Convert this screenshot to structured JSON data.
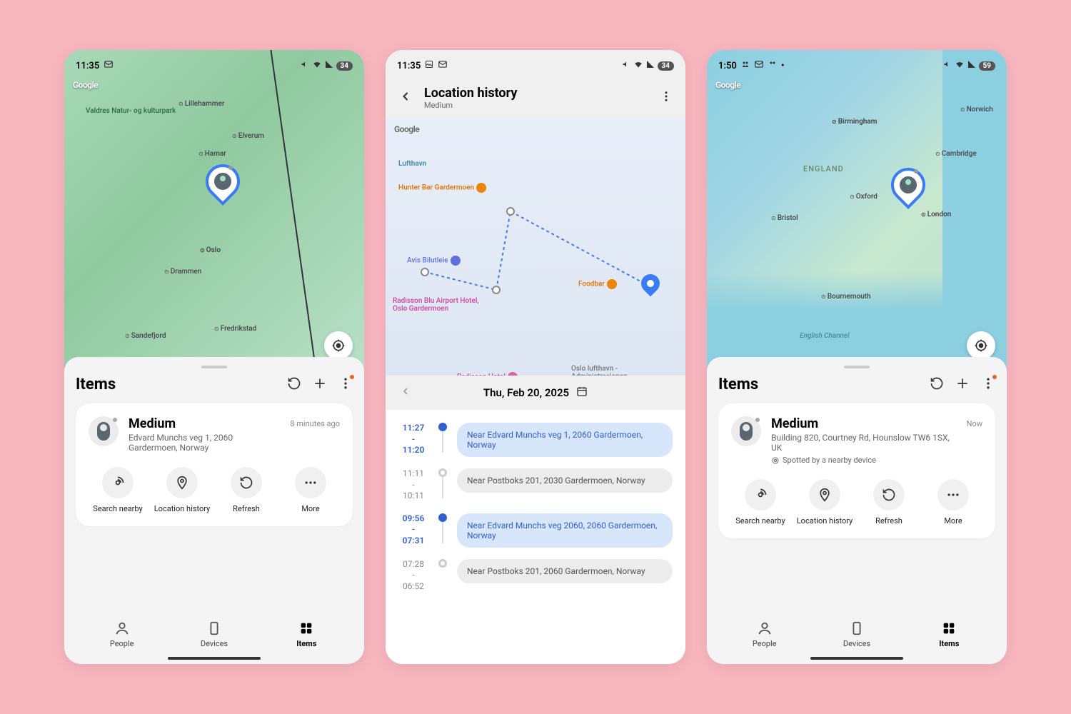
{
  "screens": {
    "s1": {
      "status": {
        "time": "11:35",
        "battery": "34"
      },
      "google": "Google",
      "map_labels": {
        "valdres": "Valdres Natur- og kulturpark",
        "lillehammer": "Lillehammer",
        "elverum": "Elverum",
        "hamar": "Hamar",
        "oslo": "Oslo",
        "drammen": "Drammen",
        "sandefjord": "Sandefjord",
        "fredrikstad": "Fredrikstad"
      },
      "sheet_title": "Items",
      "item": {
        "name": "Medium",
        "address": "Edvard Munchs veg 1, 2060 Gardermoen, Norway",
        "time": "8 minutes ago"
      },
      "actions": {
        "search": "Search nearby",
        "history": "Location history",
        "refresh": "Refresh",
        "more": "More"
      },
      "nav": {
        "people": "People",
        "devices": "Devices",
        "items": "Items"
      }
    },
    "s2": {
      "status": {
        "time": "11:35",
        "battery": "34"
      },
      "header": {
        "title": "Location history",
        "sub": "Medium"
      },
      "google": "Google",
      "map_labels": {
        "lufthavn": "Lufthavn",
        "hunter": "Hunter Bar Gardermoen",
        "avis": "Avis Bilutleie",
        "foodbar": "Foodbar",
        "radisson": "Radisson Blu Airport Hotel, Oslo Gardermoen",
        "radisson2": "Radisson Hotel",
        "admin": "Oslo lufthavn - Administrasjonen"
      },
      "date": "Thu, Feb 20, 2025",
      "history": [
        {
          "t1": "11:27",
          "t2": "11:20",
          "text": "Near Edvard Munchs veg 1, 2060 Gardermoen, Norway",
          "active": true
        },
        {
          "t1": "11:11",
          "t2": "10:11",
          "text": "Near Postboks 201, 2030 Gardermoen, Norway",
          "active": false
        },
        {
          "t1": "09:56",
          "t2": "07:31",
          "text": "Near Edvard Munchs veg 2060, 2060 Gardermoen, Norway",
          "active": true
        },
        {
          "t1": "07:28",
          "t2": "06:52",
          "text": "Near Postboks 201, 2060 Gardermoen, Norway",
          "active": false
        }
      ]
    },
    "s3": {
      "status": {
        "time": "1:50",
        "battery": "59"
      },
      "google": "Google",
      "map_labels": {
        "birmingham": "Birmingham",
        "norwich": "Norwich",
        "cambridge": "Cambridge",
        "england": "ENGLAND",
        "oxford": "Oxford",
        "london": "London",
        "bristol": "Bristol",
        "bournemouth": "Bournemouth",
        "channel": "English Channel"
      },
      "sheet_title": "Items",
      "item": {
        "name": "Medium",
        "address": "Building 820, Courtney Rd, Hounslow TW6 1SX, UK",
        "spotted": "Spotted by a nearby device",
        "time": "Now"
      },
      "actions": {
        "search": "Search nearby",
        "history": "Location history",
        "refresh": "Refresh",
        "more": "More"
      },
      "nav": {
        "people": "People",
        "devices": "Devices",
        "items": "Items"
      }
    }
  }
}
